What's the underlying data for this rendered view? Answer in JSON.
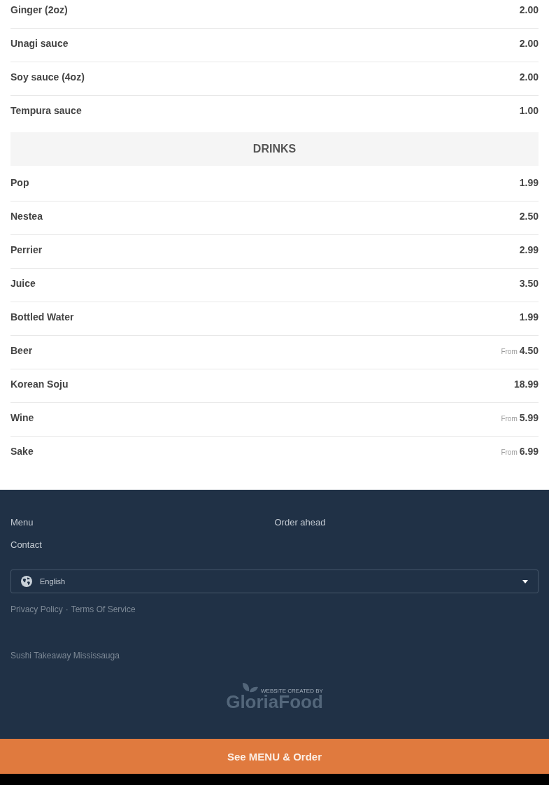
{
  "sections": [
    {
      "items": [
        {
          "name": "Ginger (2oz)",
          "price": "2.00"
        },
        {
          "name": "Unagi sauce",
          "price": "2.00"
        },
        {
          "name": "Soy sauce (4oz)",
          "price": "2.00"
        },
        {
          "name": "Tempura sauce",
          "price": "1.00"
        }
      ]
    },
    {
      "heading": "DRINKS",
      "items": [
        {
          "name": "Pop",
          "price": "1.99"
        },
        {
          "name": "Nestea",
          "price": "2.50"
        },
        {
          "name": "Perrier",
          "price": "2.99"
        },
        {
          "name": "Juice",
          "price": "3.50"
        },
        {
          "name": "Bottled Water",
          "price": "1.99"
        },
        {
          "name": "Beer",
          "price_prefix": "From",
          "price": "4.50"
        },
        {
          "name": "Korean Soju",
          "price": "18.99"
        },
        {
          "name": "Wine",
          "price_prefix": "From",
          "price": "5.99"
        },
        {
          "name": "Sake",
          "price_prefix": "From",
          "price": "6.99"
        }
      ]
    }
  ],
  "footer": {
    "nav_links": [
      "Menu",
      "Order ahead",
      "Contact"
    ],
    "language_select": {
      "value": "English"
    },
    "legal_links": [
      "Privacy Policy",
      "Terms Of Service"
    ],
    "legal_separator": "·",
    "restaurant_name": "Sushi Takeaway Mississauga",
    "credit": {
      "caption": "WEBSITE CREATED BY",
      "brand": "GloriaFood"
    }
  },
  "cta_button": {
    "label": "See MENU & Order"
  }
}
